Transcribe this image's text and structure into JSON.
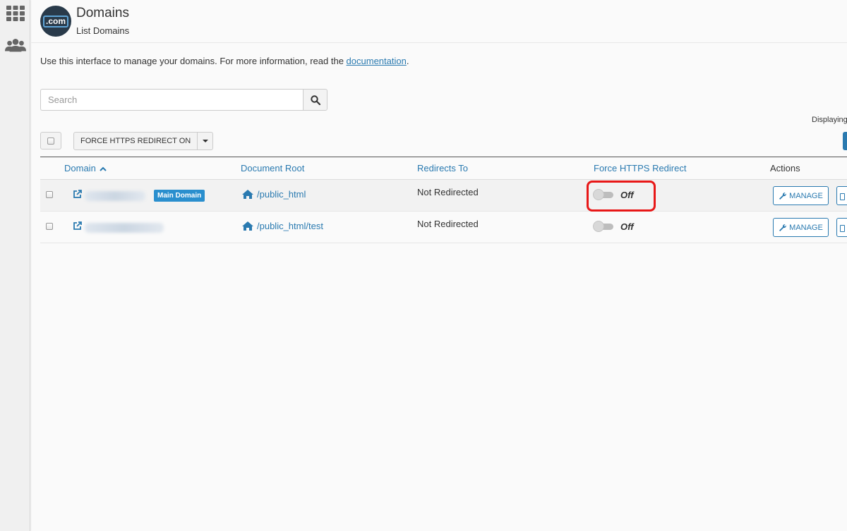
{
  "sidebar": {
    "items": [
      {
        "icon": "apps-grid-icon"
      },
      {
        "icon": "users-icon"
      }
    ]
  },
  "header": {
    "logo_text": ".com",
    "title": "Domains",
    "subtitle": "List Domains"
  },
  "intro": {
    "text": "Use this interface to manage your domains. For more information, read the ",
    "link": "documentation",
    "suffix": "."
  },
  "search": {
    "placeholder": "Search",
    "value": ""
  },
  "toolbar": {
    "force_button_label": "FORCE HTTPS REDIRECT ON",
    "displaying_text": "Displaying"
  },
  "table": {
    "columns": {
      "domain": "Domain",
      "document_root": "Document Root",
      "redirects_to": "Redirects To",
      "force_https": "Force HTTPS Redirect",
      "actions": "Actions"
    },
    "sort": {
      "column": "domain",
      "direction": "ascending"
    },
    "rows": [
      {
        "badge": "Main Domain",
        "document_root": "/public_html",
        "redirects_to": "Not Redirected",
        "force_https": "Off",
        "manage_label": "MANAGE"
      },
      {
        "badge": "",
        "document_root": "/public_html/test",
        "redirects_to": "Not Redirected",
        "force_https": "Off",
        "manage_label": "MANAGE"
      }
    ]
  },
  "colors": {
    "accent": "#2a7ab0",
    "badge": "#2a8fce",
    "highlight": "#e81818",
    "logo_bg": "#293a4a"
  }
}
